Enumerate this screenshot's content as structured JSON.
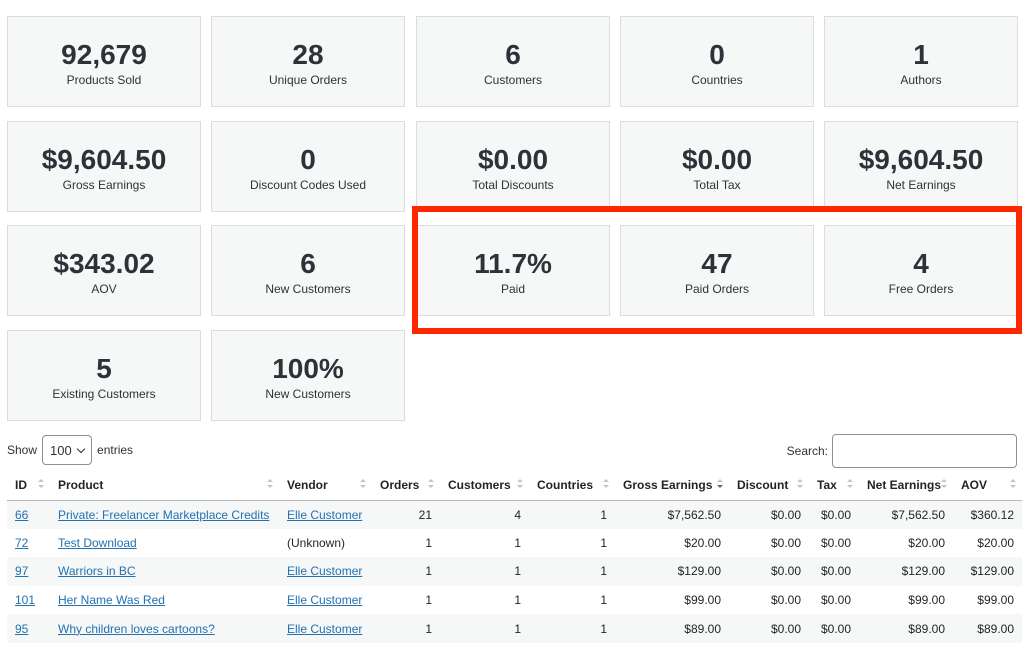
{
  "stats": [
    {
      "value": "92,679",
      "label": "Products Sold"
    },
    {
      "value": "28",
      "label": "Unique Orders"
    },
    {
      "value": "6",
      "label": "Customers"
    },
    {
      "value": "0",
      "label": "Countries"
    },
    {
      "value": "1",
      "label": "Authors"
    },
    {
      "value": "$9,604.50",
      "label": "Gross Earnings"
    },
    {
      "value": "0",
      "label": "Discount Codes Used"
    },
    {
      "value": "$0.00",
      "label": "Total Discounts"
    },
    {
      "value": "$0.00",
      "label": "Total Tax"
    },
    {
      "value": "$9,604.50",
      "label": "Net Earnings"
    },
    {
      "value": "$343.02",
      "label": "AOV"
    },
    {
      "value": "6",
      "label": "New Customers"
    },
    {
      "value": "11.7%",
      "label": "Paid"
    },
    {
      "value": "47",
      "label": "Paid Orders"
    },
    {
      "value": "4",
      "label": "Free Orders"
    },
    {
      "value": "5",
      "label": "Existing Customers"
    },
    {
      "value": "100%",
      "label": "New Customers"
    }
  ],
  "controls": {
    "show_label": "Show",
    "entries_value": "100",
    "entries_label": "entries",
    "search_label": "Search:"
  },
  "table": {
    "headers": [
      "ID",
      "Product",
      "Vendor",
      "Orders",
      "Customers",
      "Countries",
      "Gross Earnings",
      "Discount",
      "Tax",
      "Net Earnings",
      "AOV"
    ],
    "rows": [
      {
        "id": "66",
        "product": "Private: Freelancer Marketplace Credits",
        "vendor": "Elle Customer",
        "orders": "21",
        "customers": "4",
        "countries": "1",
        "gross": "$7,562.50",
        "discount": "$0.00",
        "tax": "$0.00",
        "net": "$7,562.50",
        "aov": "$360.12"
      },
      {
        "id": "72",
        "product": "Test Download",
        "vendor": "(Unknown)",
        "orders": "1",
        "customers": "1",
        "countries": "1",
        "gross": "$20.00",
        "discount": "$0.00",
        "tax": "$0.00",
        "net": "$20.00",
        "aov": "$20.00"
      },
      {
        "id": "97",
        "product": "Warriors in BC",
        "vendor": "Elle Customer",
        "orders": "1",
        "customers": "1",
        "countries": "1",
        "gross": "$129.00",
        "discount": "$0.00",
        "tax": "$0.00",
        "net": "$129.00",
        "aov": "$129.00"
      },
      {
        "id": "101",
        "product": "Her Name Was Red",
        "vendor": "Elle Customer",
        "orders": "1",
        "customers": "1",
        "countries": "1",
        "gross": "$99.00",
        "discount": "$0.00",
        "tax": "$0.00",
        "net": "$99.00",
        "aov": "$99.00"
      },
      {
        "id": "95",
        "product": "Why children loves cartoons?",
        "vendor": "Elle Customer",
        "orders": "1",
        "customers": "1",
        "countries": "1",
        "gross": "$89.00",
        "discount": "$0.00",
        "tax": "$0.00",
        "net": "$89.00",
        "aov": "$89.00"
      }
    ]
  },
  "colors": {
    "highlight": "#ff2600",
    "link": "#2271b1",
    "card_bg": "#f6f7f7"
  }
}
